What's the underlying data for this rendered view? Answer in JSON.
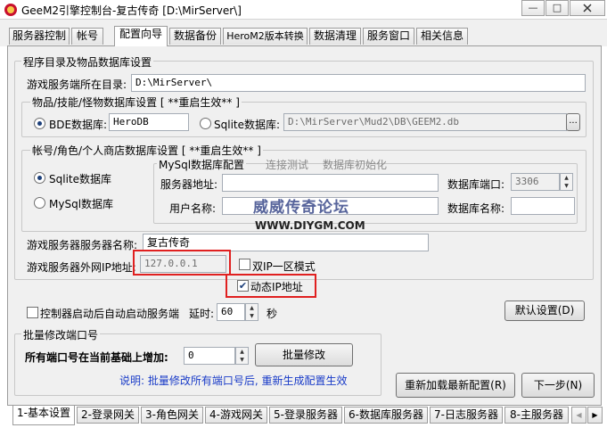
{
  "window": {
    "title": "GeeM2引擎控制台-复古传奇 [D:\\MirServer\\]",
    "minimize": "—",
    "maximize": "□"
  },
  "top_tabs": [
    "服务器控制",
    "帐号",
    "配置向导",
    "数据备份",
    "HeroM2版本转换",
    "数据清理",
    "服务窗口",
    "相关信息"
  ],
  "main": {
    "group_title": "程序目录及物品数据库设置",
    "server_dir_label": "游戏服务端所在目录:",
    "server_dir_value": "D:\\MirServer\\",
    "item_db": {
      "title": "物品/技能/怪物数据库设置 [ **重启生效** ]",
      "bde_label": "BDE数据库:",
      "bde_value": "HeroDB",
      "sqlite_label": "Sqlite数据库:",
      "sqlite_value": "D:\\MirServer\\Mud2\\DB\\GEEM2.db",
      "browse": "..."
    },
    "account_db": {
      "title": "帐号/角色/个人商店数据库设置 [ **重启生效** ]",
      "sqlite_label": "Sqlite数据库",
      "mysql_label": "MySql数据库",
      "mysql_config_title": "MySql数据库配置",
      "test_link": "连接测试",
      "init_link": "数据库初始化",
      "server_addr_label": "服务器地址:",
      "port_label": "数据库端口:",
      "port_value": "3306",
      "username_label": "用户名称:",
      "dbname_label": "数据库名称:"
    },
    "watermark_title": "威威传奇论坛",
    "watermark_url": "WWW.DIYGM.COM",
    "server_name_label": "游戏服务器服务器名称:",
    "server_name_value": "复古传奇",
    "server_ip_label": "游戏服务器外网IP地址:",
    "server_ip_value": "127.0.0.1",
    "dual_ip_label": "双IP一区模式",
    "dynamic_ip_label": "动态IP地址",
    "autostart_label": "控制器启动后自动启动服务端",
    "delay_label": "延时:",
    "delay_value": "60",
    "delay_unit": "秒",
    "default_btn": "默认设置(D)",
    "batch_port": {
      "title": "批量修改端口号",
      "increase_label": "所有端口号在当前基础上增加:",
      "increase_value": "0",
      "batch_btn": "批量修改",
      "note": "说明: 批量修改所有端口号后, 重新生成配置生效"
    },
    "reload_btn": "重新加载最新配置(R)",
    "next_btn": "下一步(N)"
  },
  "bottom_tabs": [
    "1-基本设置",
    "2-登录网关",
    "3-角色网关",
    "4-游戏网关",
    "5-登录服务器",
    "6-数据库服务器",
    "7-日志服务器",
    "8-主服务器"
  ],
  "colors": {
    "highlight": "#e02020",
    "note_text": "#1a3cc8",
    "accent": "#1c3f7a"
  },
  "checkbox_states": {
    "dual_ip": false,
    "dynamic_ip": true,
    "autostart": false
  },
  "radio_states": {
    "item_db": "bde",
    "account_db": "sqlite"
  }
}
